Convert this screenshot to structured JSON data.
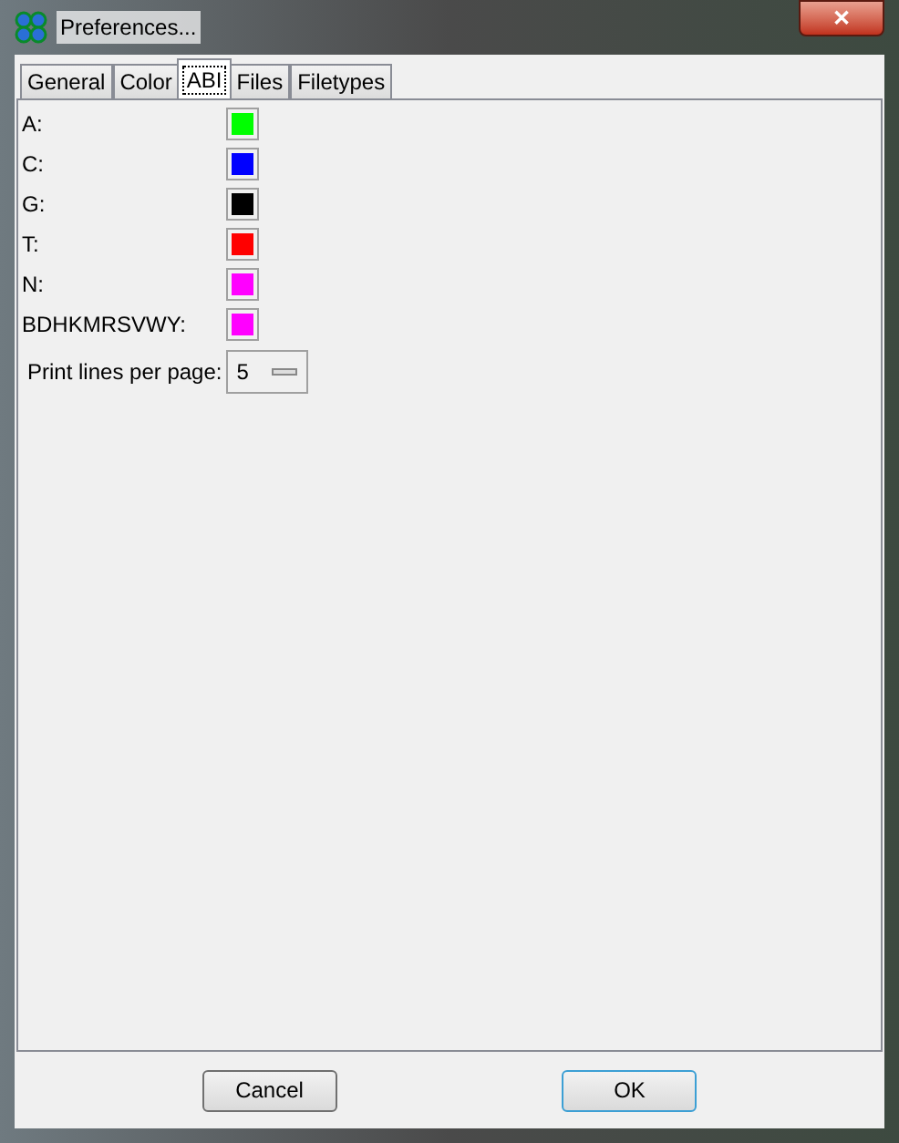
{
  "window": {
    "title": "Preferences...",
    "close": "✕"
  },
  "tabs": [
    {
      "label": "General",
      "selected": false
    },
    {
      "label": "Color",
      "selected": false
    },
    {
      "label": "ABI",
      "selected": true
    },
    {
      "label": "Files",
      "selected": false
    },
    {
      "label": "Filetypes",
      "selected": false
    }
  ],
  "colors": [
    {
      "label": "A:",
      "color": "#00ff00"
    },
    {
      "label": "C:",
      "color": "#0000ff"
    },
    {
      "label": "G:",
      "color": "#000000"
    },
    {
      "label": "T:",
      "color": "#ff0000"
    },
    {
      "label": "N:",
      "color": "#ff00ff"
    },
    {
      "label": "BDHKMRSVWY:",
      "color": "#ff00ff"
    }
  ],
  "print_lines": {
    "label": "Print lines per page:",
    "value": "5"
  },
  "buttons": [
    {
      "label": "Cancel",
      "kind": "normal"
    },
    {
      "label": "OK",
      "kind": "default"
    }
  ]
}
